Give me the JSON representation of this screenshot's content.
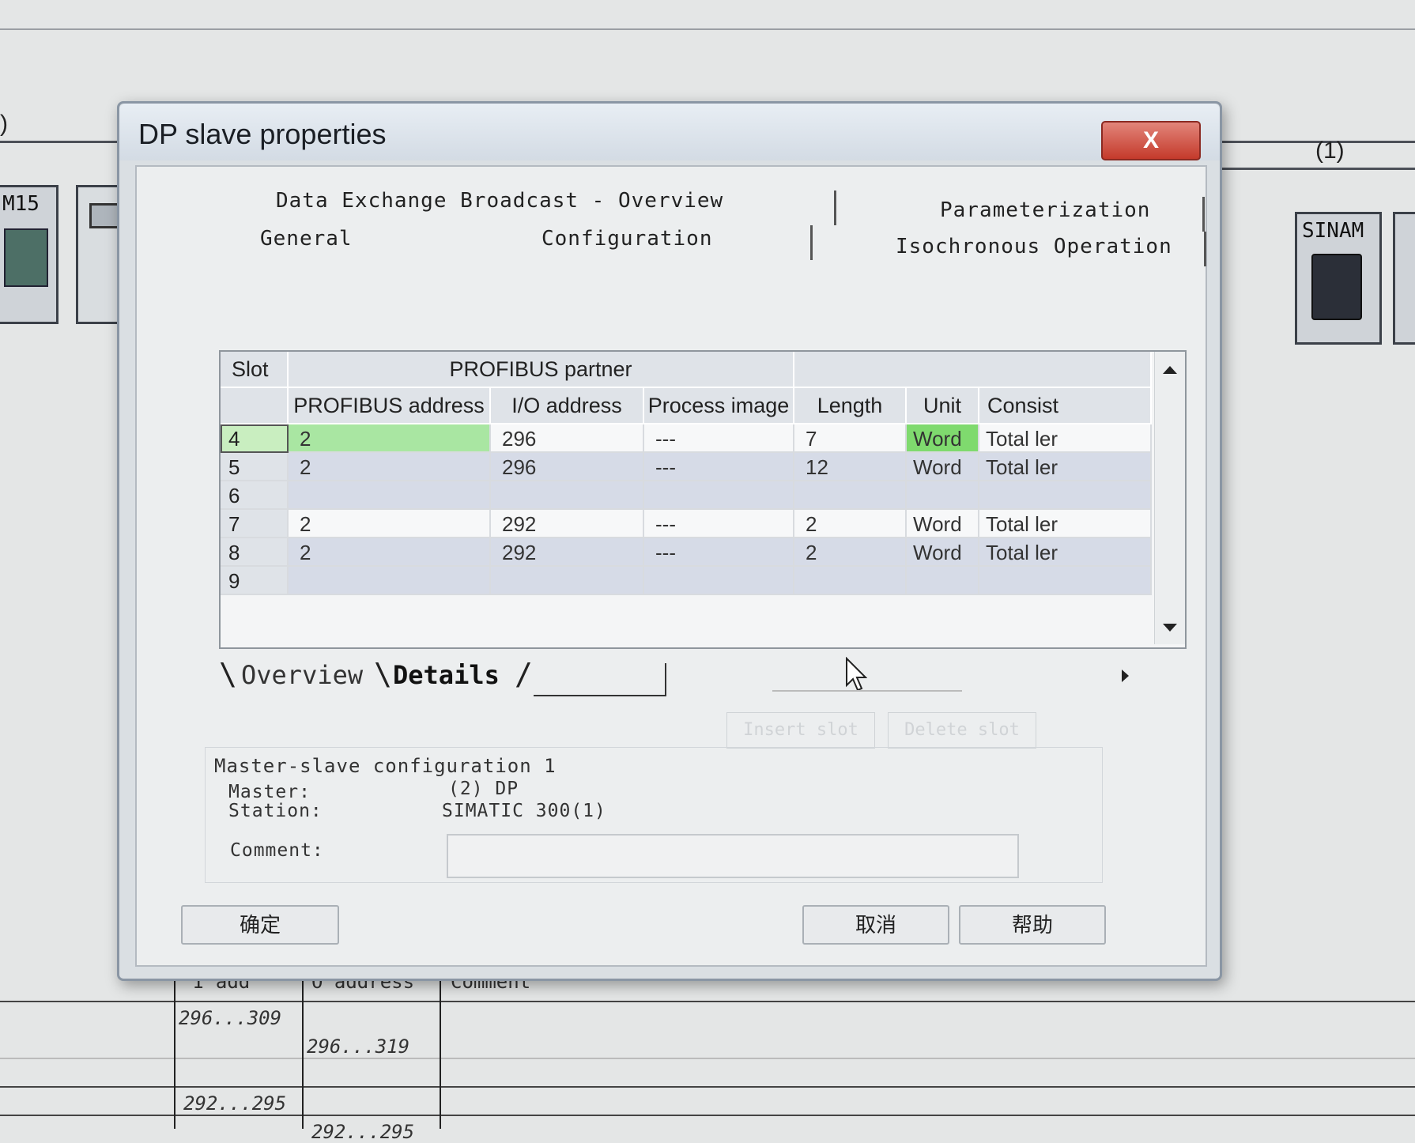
{
  "background": {
    "partial_label_left": ")",
    "partial_label_right": "(1)",
    "module_left_label": "M15",
    "module_right_label": "SINAM",
    "table": {
      "header_fragments": [
        "I add",
        "O address",
        "Comment"
      ],
      "rows": [
        {
          "i_address": "296...309",
          "o_address": ""
        },
        {
          "i_address": "",
          "o_address": "296...319"
        },
        {
          "i_address": "",
          "o_address": ""
        },
        {
          "i_address": "292...295",
          "o_address": ""
        },
        {
          "i_address": "",
          "o_address": "292...295"
        }
      ]
    }
  },
  "dialog": {
    "title": "DP slave properties",
    "close_label": "X",
    "tabs": {
      "data_exchange": "Data Exchange Broadcast - Overview",
      "parameterization": "Parameterization",
      "general": "General",
      "configuration": "Configuration",
      "isochronous": "Isochronous Operation"
    },
    "grid": {
      "headers": {
        "slot": "Slot",
        "profibus_partner": "PROFIBUS partner",
        "profibus_address": "PROFIBUS address",
        "io_address": "I/O address",
        "process_image": "Process image",
        "length": "Length",
        "unit": "Unit",
        "consistency": "Consist"
      },
      "rows": [
        {
          "slot": "4",
          "address": "2",
          "io": "296",
          "image": "---",
          "length": "7",
          "unit": "Word",
          "consist": "Total ler"
        },
        {
          "slot": "5",
          "address": "2",
          "io": "296",
          "image": "---",
          "length": "12",
          "unit": "Word",
          "consist": "Total ler"
        },
        {
          "slot": "6",
          "address": "",
          "io": "",
          "image": "",
          "length": "",
          "unit": "",
          "consist": ""
        },
        {
          "slot": "7",
          "address": "2",
          "io": "292",
          "image": "---",
          "length": "2",
          "unit": "Word",
          "consist": "Total ler"
        },
        {
          "slot": "8",
          "address": "2",
          "io": "292",
          "image": "---",
          "length": "2",
          "unit": "Word",
          "consist": "Total ler"
        },
        {
          "slot": "9",
          "address": "",
          "io": "",
          "image": "",
          "length": "",
          "unit": "",
          "consist": ""
        }
      ]
    },
    "sheet_tabs": {
      "overview": "Overview",
      "details": "Details"
    },
    "ghost_buttons": {
      "insert_slot": "Insert slot",
      "delete_slot": "Delete slot"
    },
    "details": {
      "title": "Master-slave configuration 1",
      "master_label": "Master:",
      "master_value": "(2) DP",
      "station_label": "Station:",
      "station_value": "SIMATIC 300(1)",
      "comment_label": "Comment:"
    },
    "buttons": {
      "ok": "确定",
      "cancel": "取消",
      "help": "帮助"
    }
  },
  "colors": {
    "selected_row": "#a9e6a2",
    "unit_highlight": "#7fda6e",
    "close_button": "#c43a2b"
  }
}
